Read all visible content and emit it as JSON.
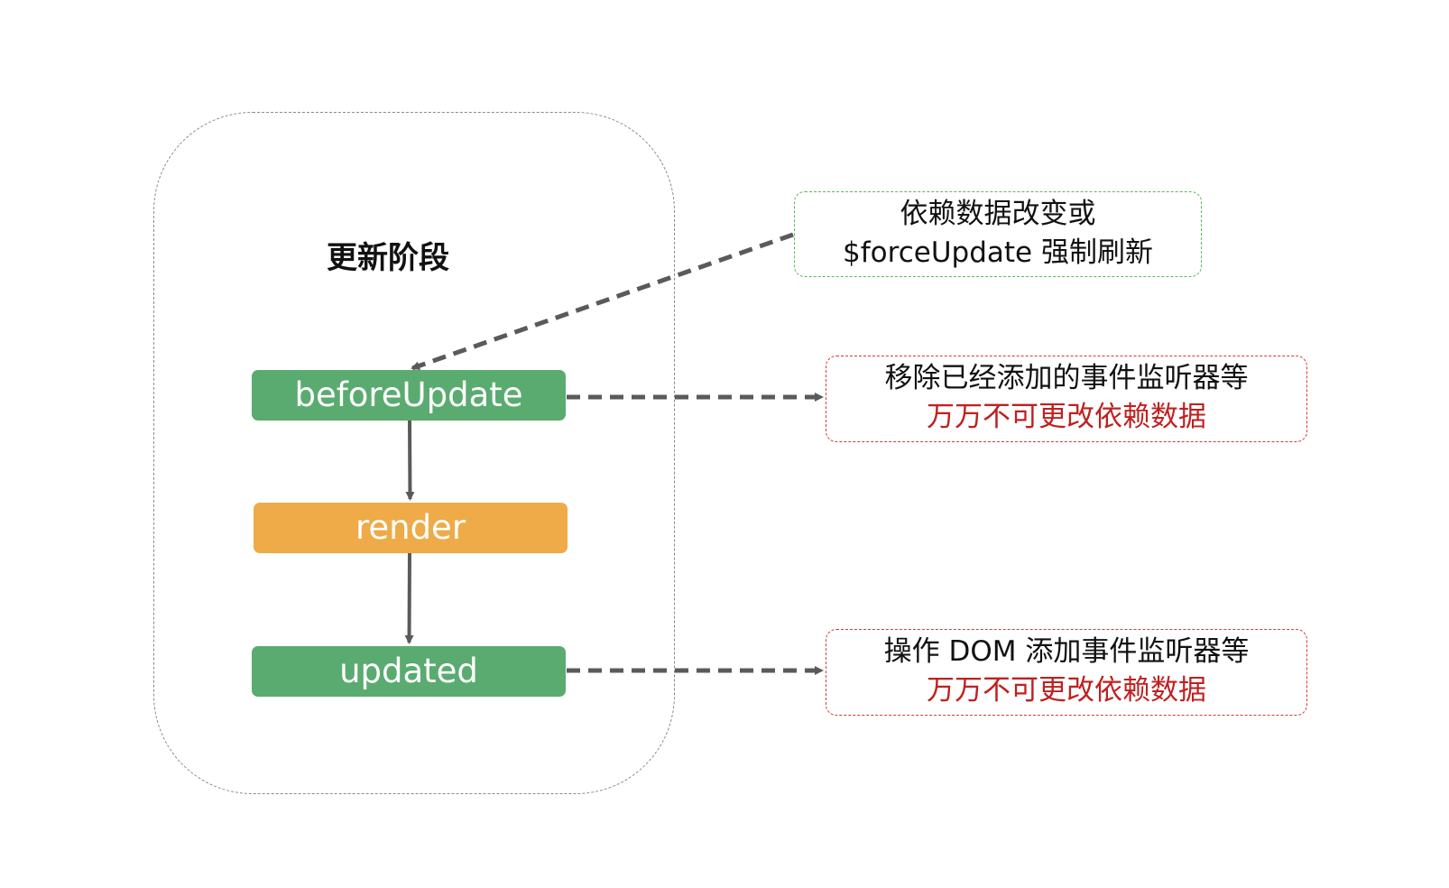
{
  "phase": {
    "title": "更新阶段"
  },
  "nodes": {
    "before_update": "beforeUpdate",
    "render": "render",
    "updated": "updated"
  },
  "notes": {
    "trigger": {
      "line1": "依赖数据改变或",
      "line2": "$forceUpdate 强制刷新"
    },
    "before_update": {
      "line1": "移除已经添加的事件监听器等",
      "line2": "万万不可更改依赖数据"
    },
    "updated": {
      "line1": "操作 DOM 添加事件监听器等",
      "line2": "万万不可更改依赖数据"
    }
  },
  "colors": {
    "green_node": "#5aab70",
    "orange_node": "#eeab48",
    "arrow": "#5a5a5a",
    "warning_text": "#c0201f",
    "trigger_border": "#5cb85c",
    "note_border": "#d43a3a"
  }
}
